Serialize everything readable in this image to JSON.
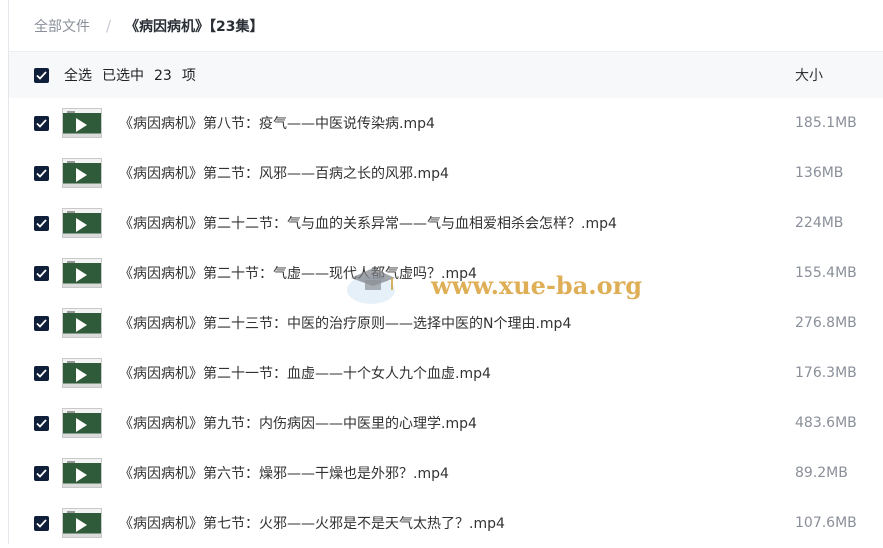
{
  "breadcrumb": {
    "root": "全部文件",
    "separator": "/",
    "current": "《病因病机》【23集】"
  },
  "header": {
    "select_all": "全选",
    "selected_prefix": "已选中",
    "selected_count": "23",
    "selected_suffix": "项",
    "size_column": "大小"
  },
  "files": [
    {
      "name": "《病因病机》第八节：疫气——中医说传染病.mp4",
      "size": "185.1MB"
    },
    {
      "name": "《病因病机》第二节：风邪——百病之长的风邪.mp4",
      "size": "136MB"
    },
    {
      "name": "《病因病机》第二十二节：气与血的关系异常——气与血相爱相杀会怎样？.mp4",
      "size": "224MB"
    },
    {
      "name": "《病因病机》第二十节：气虚——现代人都气虚吗？.mp4",
      "size": "155.4MB"
    },
    {
      "name": "《病因病机》第二十三节：中医的治疗原则——选择中医的N个理由.mp4",
      "size": "276.8MB"
    },
    {
      "name": "《病因病机》第二十一节：血虚——十个女人九个血虚.mp4",
      "size": "176.3MB"
    },
    {
      "name": "《病因病机》第九节：内伤病因——中医里的心理学.mp4",
      "size": "483.6MB"
    },
    {
      "name": "《病因病机》第六节：燥邪——干燥也是外邪？.mp4",
      "size": "89.2MB"
    },
    {
      "name": "《病因病机》第七节：火邪——火邪是不是天气太热了？.mp4",
      "size": "107.6MB"
    }
  ],
  "watermark": "www.xue-ba.org",
  "colors": {
    "checkbox": "#0f1f3a",
    "header_bg": "#f7f8fa",
    "muted_text": "#8a8f99",
    "watermark": "#d9a23a"
  }
}
